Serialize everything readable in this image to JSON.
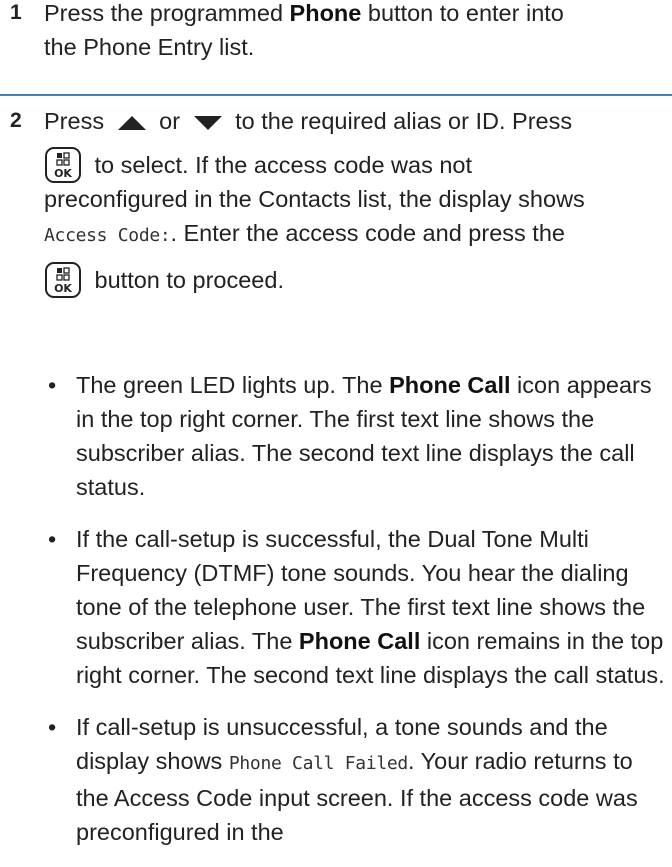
{
  "step1": {
    "number": "1",
    "text_a": "Press the programmed ",
    "bold_phone": "Phone",
    "text_b": " button to enter into",
    "text_c": "the Phone Entry list."
  },
  "step2": {
    "number": "2",
    "p1_a": "Press ",
    "p1_or": " or ",
    "p1_b": " to the required alias or ID. Press",
    "p2_a": " to select. If the access code was not",
    "p2_b": "preconfigured in the Contacts list, the display shows",
    "access_code_label": "Access Code:",
    "p2_c": ". Enter the access code and press the",
    "p3_a": " button to proceed.",
    "bullets": [
      {
        "a": "The green LED lights up. The ",
        "bold": "Phone Call",
        "b": " icon appears in the top right corner. The first text line shows the subscriber alias. The second text line displays the call status."
      },
      {
        "a": "If the call-setup is successful, the Dual Tone Multi Frequency (DTMF) tone sounds. You hear the dialing tone of the telephone user. The first text line shows the subscriber alias. The ",
        "bold": "Phone Call",
        "b": " icon remains in the top right corner. The second text line displays the call status."
      },
      {
        "a": "If call-setup is unsuccessful, a tone sounds and the display shows ",
        "mono": "Phone Call Failed",
        "b": ". Your radio returns to the Access Code input screen. If the access code was preconfigured in the"
      }
    ]
  },
  "icons": {
    "up": "triangle-up-icon",
    "down": "triangle-down-icon",
    "ok": "menu-ok-key-icon",
    "ok_text": "OK",
    "rule_color": "#4a7fb5"
  }
}
